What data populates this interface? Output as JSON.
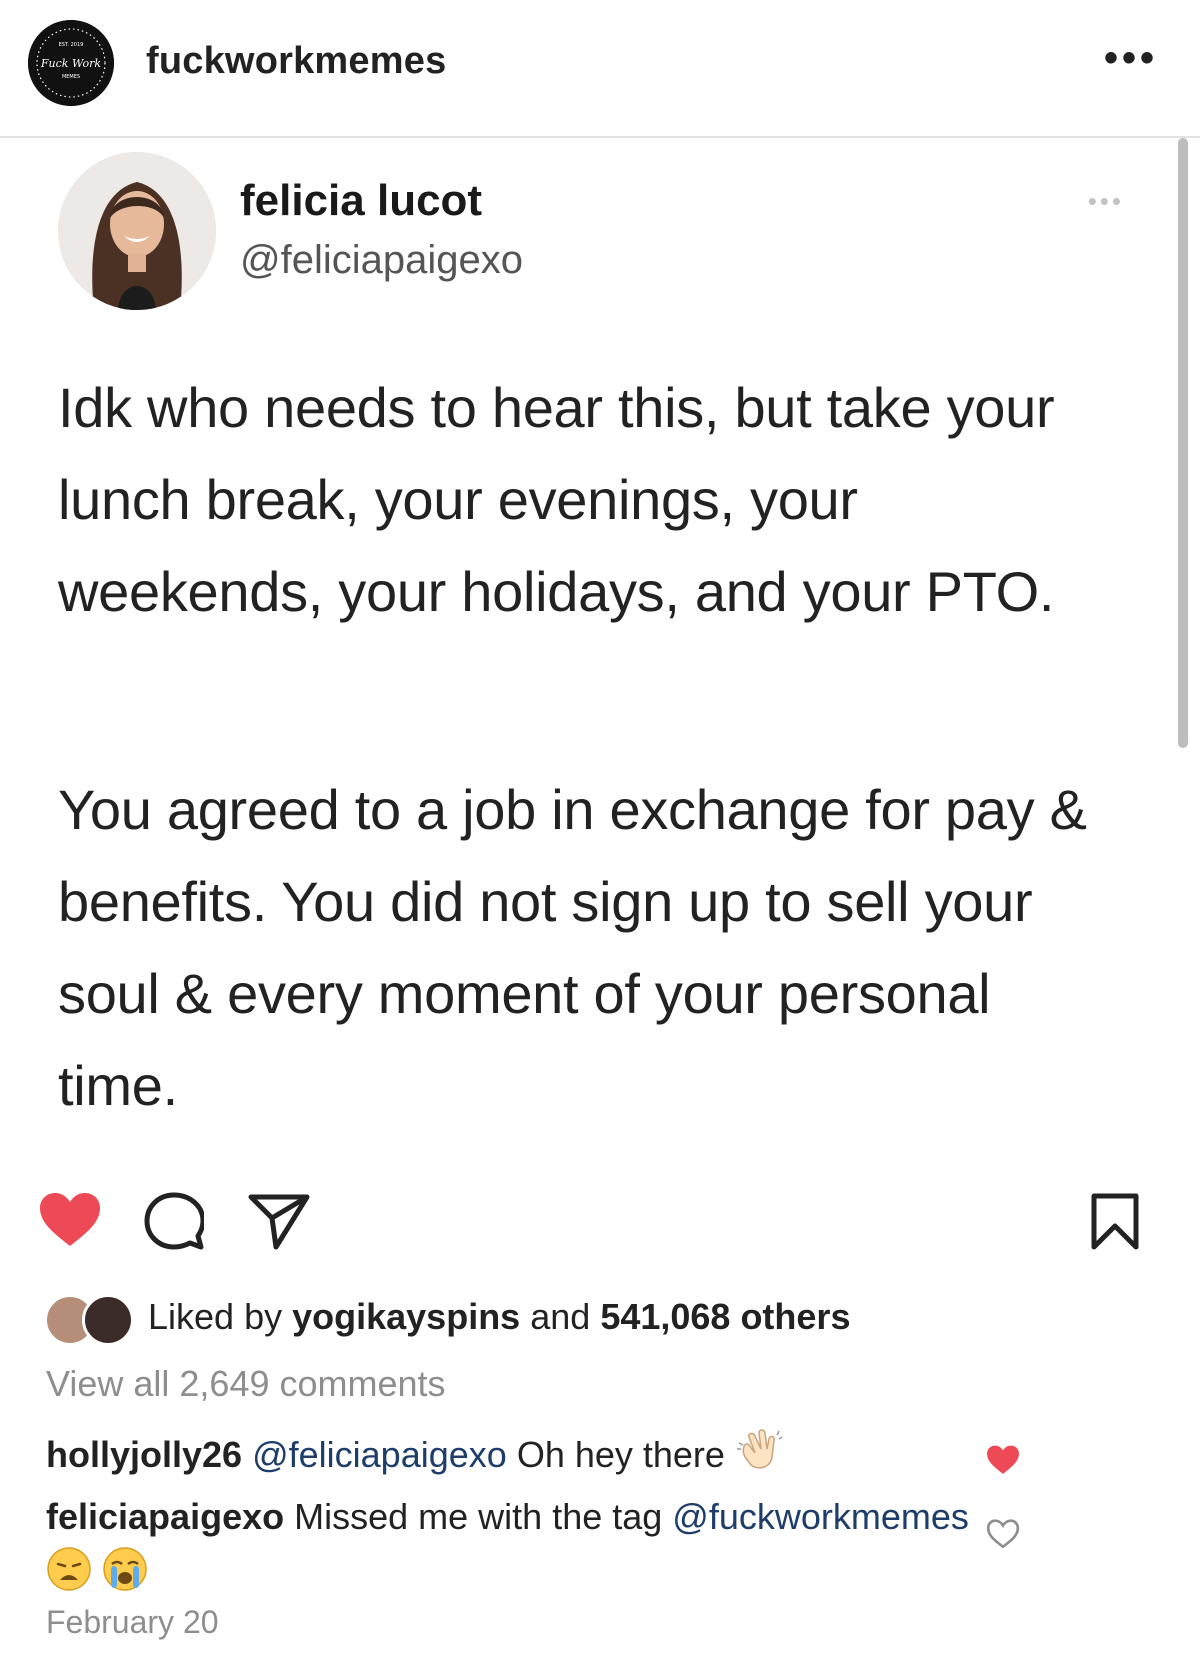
{
  "header": {
    "account_name": "fuckworkmemes",
    "avatar_text_top": "EST. 2019",
    "avatar_text_mid": "Fuck Work",
    "avatar_text_bottom": "MEMES",
    "more_label": "•••"
  },
  "tweet": {
    "display_name": "felicia lucot",
    "handle": "@feliciapaigexo",
    "more_label": "•••",
    "paragraph_1": "Idk who needs to hear this, but take your lunch break, your evenings, your weekends, your holidays, and your PTO.",
    "paragraph_2": "You agreed to a job in exchange for pay & benefits. You did not sign up to sell your soul & every moment of your personal time."
  },
  "actions": {
    "like_icon": "heart-filled-icon",
    "comment_icon": "comment-bubble-icon",
    "share_icon": "paper-plane-icon",
    "save_icon": "bookmark-icon",
    "like_color": "#ed4956"
  },
  "likes": {
    "prefix": "Liked by",
    "first_liker": "yogikayspins",
    "connector": "and",
    "others": "541,068 others"
  },
  "view_all_comments": "View all 2,649 comments",
  "comments": [
    {
      "user": "hollyjolly26",
      "mention": "@feliciapaigexo",
      "text": "Oh hey there",
      "liked": true
    },
    {
      "user": "feliciapaigexo",
      "text": "Missed me with the tag",
      "mention": "@fuckworkmemes",
      "liked": false
    }
  ],
  "date": "February 20"
}
